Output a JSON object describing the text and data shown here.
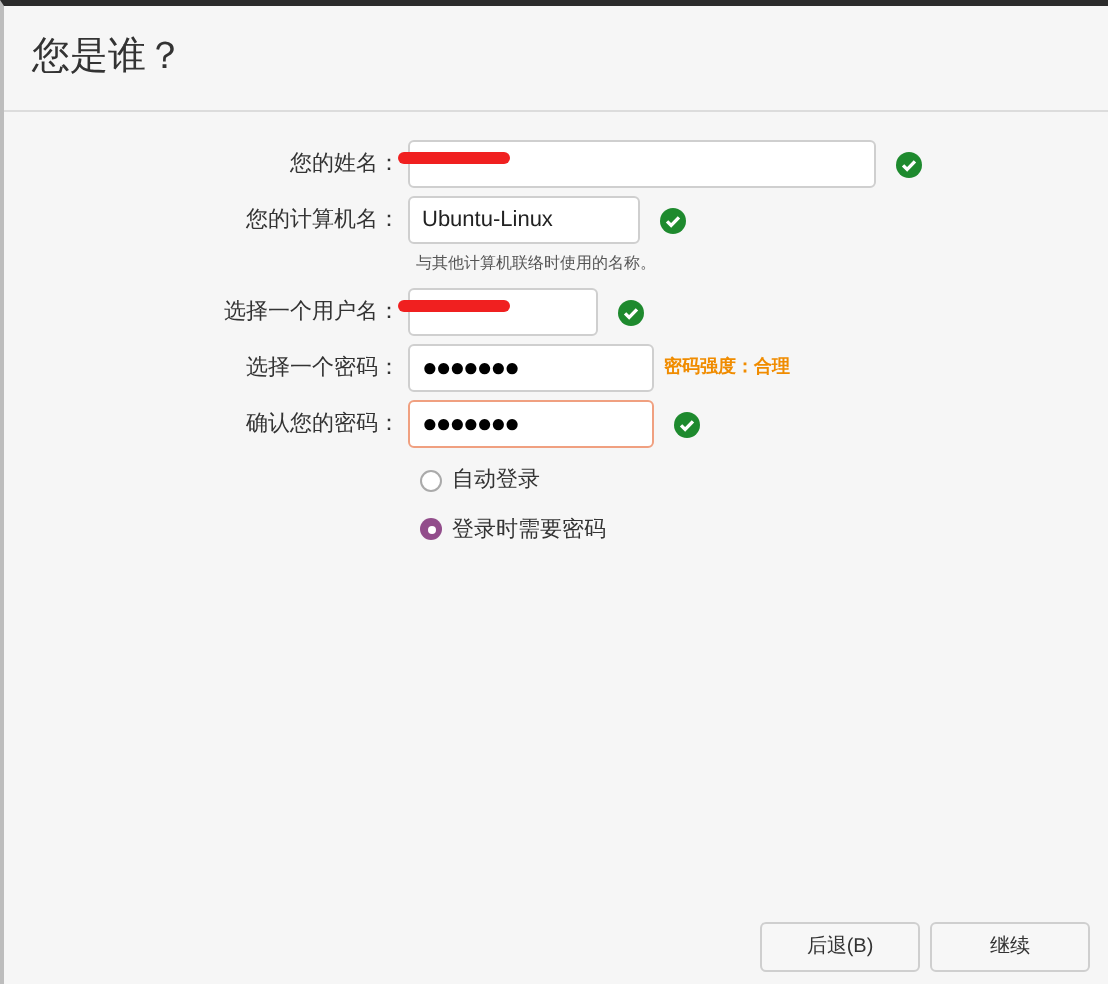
{
  "window": {
    "title": "您是谁？"
  },
  "fields": [
    {
      "label": "您的姓名：",
      "redacted": true,
      "valid": true,
      "error": false
    },
    {
      "label": "您的计算机名：",
      "value": "Ubuntu-Linux",
      "redacted": false,
      "valid": true,
      "error": false,
      "hint": "与其他计算机联络时使用的名称。"
    },
    {
      "label": "选择一个用户名：",
      "redacted": true,
      "valid": true,
      "error": false
    },
    {
      "label": "选择一个密码：",
      "value": "●●●●●●●",
      "redacted": false,
      "valid": false,
      "error": false,
      "strength": "密码强度：合理"
    },
    {
      "label": "确认您的密码：",
      "value": "●●●●●●●",
      "redacted": false,
      "valid": true,
      "error": true
    }
  ],
  "login_options": [
    {
      "label": "自动登录",
      "selected": false
    },
    {
      "label": "登录时需要密码",
      "selected": true
    }
  ],
  "buttons": [
    {
      "label": "后退(B)"
    },
    {
      "label": "继续"
    }
  ]
}
